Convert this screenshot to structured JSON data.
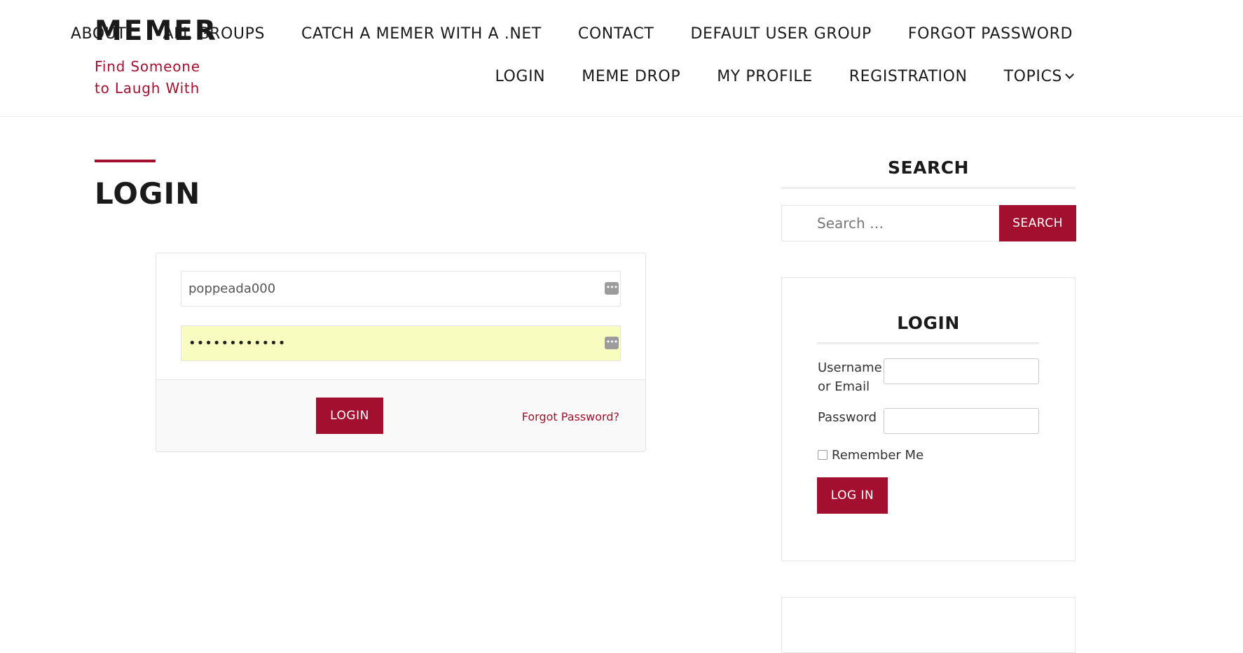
{
  "site": {
    "title": "MEMER",
    "tagline": "Find Someone to Laugh With"
  },
  "nav": {
    "row1": [
      "ABOUT",
      "ALL GROUPS",
      "CATCH A MEMER WITH A .NET",
      "CONTACT",
      "DEFAULT USER GROUP",
      "FORGOT PASSWORD"
    ],
    "row2": [
      "LOGIN",
      "MEME DROP",
      "MY PROFILE",
      "REGISTRATION",
      "TOPICS"
    ]
  },
  "page": {
    "title": "LOGIN"
  },
  "login_form": {
    "username_value": "poppeada000",
    "password_value": "••••••••••••",
    "login_button": "LOGIN",
    "forgot_link": "Forgot Password?",
    "autofill_color": "#f9fcbf"
  },
  "sidebar": {
    "search_heading": "SEARCH",
    "search_placeholder": "Search …",
    "search_button": "SEARCH",
    "login_heading": "LOGIN",
    "username_label": "Username or Email",
    "password_label": "Password",
    "remember_label": "Remember Me",
    "remember_checked": false,
    "login_button": "LOG IN"
  },
  "colors": {
    "accent": "#a3102f",
    "text": "#1a1a1a"
  },
  "icons": {
    "topics_dropdown": "chevron-down-icon",
    "password_manager": "password-manager-icon"
  }
}
